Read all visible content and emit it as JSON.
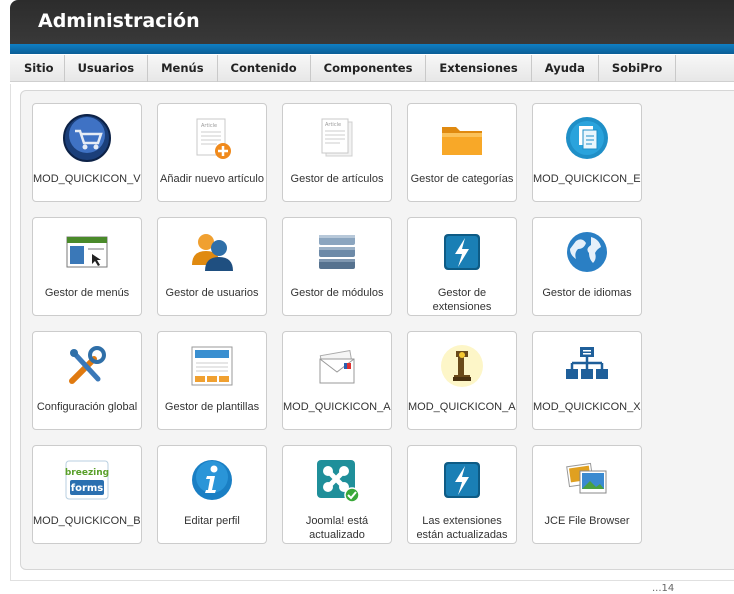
{
  "header": {
    "title": "Administración"
  },
  "menu": [
    "Sitio",
    "Usuarios",
    "Menús",
    "Contenido",
    "Componentes",
    "Extensiones",
    "Ayuda",
    "SobiPro"
  ],
  "tiles": [
    {
      "label": "MOD_QUICKICON_VM",
      "icon": "virtuemart-cart-icon"
    },
    {
      "label": "Añadir nuevo artículo",
      "icon": "add-article-icon"
    },
    {
      "label": "Gestor de artículos",
      "icon": "article-manager-icon"
    },
    {
      "label": "Gestor de categorías",
      "icon": "folder-icon"
    },
    {
      "label": "MOD_QUICKICON_EXTPLORER",
      "icon": "extplorer-icon"
    },
    {
      "label": "Gestor de menús",
      "icon": "menu-manager-icon"
    },
    {
      "label": "Gestor de usuarios",
      "icon": "users-icon"
    },
    {
      "label": "Gestor de módulos",
      "icon": "modules-icon"
    },
    {
      "label": "Gestor de extensiones",
      "icon": "extensions-icon"
    },
    {
      "label": "Gestor de idiomas",
      "icon": "globe-icon"
    },
    {
      "label": "Configuración global",
      "icon": "tools-icon"
    },
    {
      "label": "Gestor de plantillas",
      "icon": "template-icon"
    },
    {
      "label": "MOD_QUICKICON_ACYMAILING",
      "icon": "acymailing-icon"
    },
    {
      "label": "MOD_QUICKICON_AKEEBA",
      "icon": "akeeba-icon"
    },
    {
      "label": "MOD_QUICKICON_XMAP",
      "icon": "sitemap-icon"
    },
    {
      "label": "MOD_QUICKICON_BREEZINGFORMS",
      "icon": "breezingforms-icon"
    },
    {
      "label": "Editar perfil",
      "icon": "info-icon"
    },
    {
      "label": "Joomla! está actualizado",
      "icon": "joomla-icon"
    },
    {
      "label": "Las extensiones están actualizadas",
      "icon": "extensions-updated-icon"
    },
    {
      "label": "JCE File Browser",
      "icon": "jce-browser-icon"
    }
  ],
  "article_thumb_text": "Article",
  "breezing_text": [
    "breezing",
    "forms"
  ],
  "footer_fragment": "...14"
}
